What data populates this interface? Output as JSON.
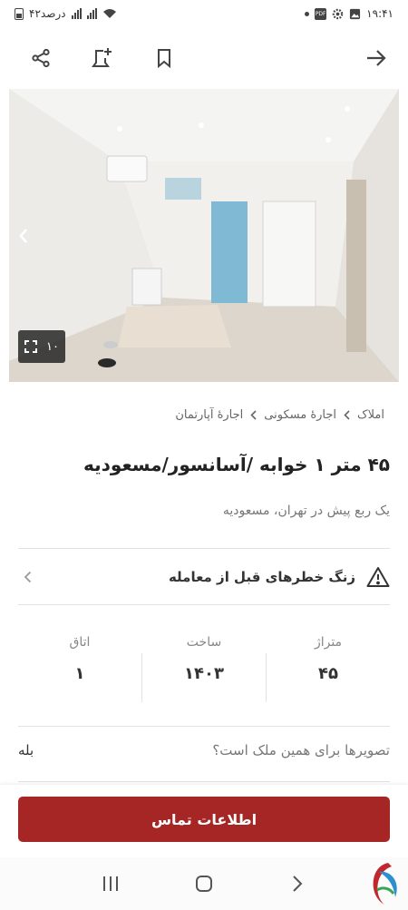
{
  "status_bar": {
    "time": "۱۹:۴۱",
    "battery": "۴۲درصد"
  },
  "toolbar": {
    "icons": [
      "share-icon",
      "add-note-icon",
      "bookmark-icon",
      "back-arrow-icon"
    ]
  },
  "gallery": {
    "photo_count": "۱۰"
  },
  "breadcrumb": [
    "املاک",
    "اجارهٔ مسکونی",
    "اجارهٔ آپارتمان"
  ],
  "listing": {
    "title": "۴۵ متر ۱ خوابه /آسانسور/مسعودیه",
    "subtitle": "یک ربع پیش در تهران، مسعودیه"
  },
  "warning": {
    "text": "زنگ خطرهای قبل از معامله"
  },
  "stats": [
    {
      "label": "متراژ",
      "value": "۴۵"
    },
    {
      "label": "ساخت",
      "value": "۱۴۰۳"
    },
    {
      "label": "اتاق",
      "value": "۱"
    }
  ],
  "question": {
    "text": "تصویرها برای همین ملک است؟",
    "answer": "بله"
  },
  "contact": {
    "label": "اطلاعات تماس"
  },
  "colors": {
    "accent": "#a62626"
  }
}
